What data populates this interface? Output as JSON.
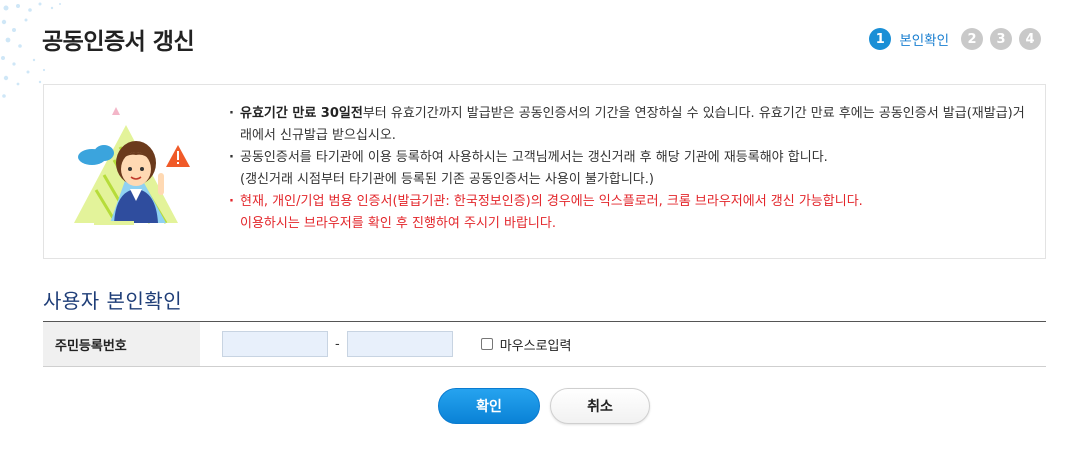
{
  "header": {
    "title": "공동인증서 갱신"
  },
  "steps": {
    "items": [
      "1",
      "2",
      "3",
      "4"
    ],
    "active_label": "본인확인"
  },
  "notice": {
    "item1_bold": "유효기간 만료 30일전",
    "item1_rest": "부터 유효기간까지 발급받은 공동인증서의 기간을 연장하실 수 있습니다. 유효기간 만료 후에는 공동인증서 발급(재발급)거래에서 신규발급 받으십시오.",
    "item2_line1": "공동인증서를 타기관에 이용 등록하여 사용하시는 고객님께서는 갱신거래 후 해당 기관에 재등록해야 합니다.",
    "item2_line2": "(갱신거래 시점부터 타기관에 등록된 기존 공동인증서는 사용이 불가합니다.)",
    "item3_line1": "현재, 개인/기업 범용 인증서(발급기관: 한국정보인증)의 경우에는 익스플로러, 크롬 브라우저에서 갱신 가능합니다.",
    "item3_line2": "이용하시는 브라우저를 확인 후 진행하여 주시기 바랍니다."
  },
  "form": {
    "section_title": "사용자 본인확인",
    "rrn_label": "주민등록번호",
    "rrn_front_value": "",
    "rrn_back_value": "",
    "dash": "-",
    "mouse_input_label": "마우스로입력",
    "mouse_input_checked": false
  },
  "buttons": {
    "confirm": "확인",
    "cancel": "취소"
  },
  "colors": {
    "primary": "#1a8fd6",
    "warning": "#e3262b",
    "section_title": "#1f3e78",
    "inactive_step": "#c9c9c9"
  }
}
